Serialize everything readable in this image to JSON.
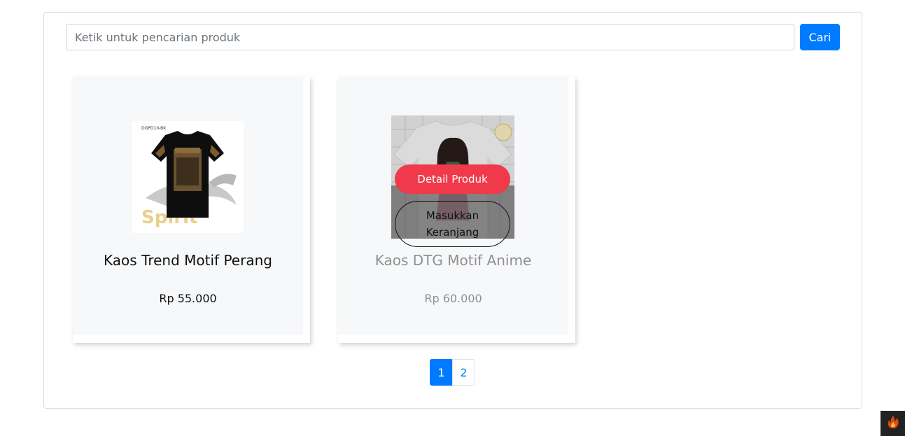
{
  "search": {
    "placeholder": "Ketik untuk pencarian produk",
    "button_label": "Cari"
  },
  "products": [
    {
      "title": "Kaos Trend Motif Perang",
      "price": "Rp 55.000",
      "image_text": "Spirit",
      "image_code": "DGPD10-BK"
    },
    {
      "title": "Kaos DTG Motif Anime",
      "price": "Rp 60.000",
      "detail_label": "Detail Produk",
      "cart_label": "Masukkan Keranjang"
    }
  ],
  "pagination": {
    "pages": [
      "1",
      "2"
    ],
    "active_page": "1"
  },
  "colors": {
    "primary": "#007bff",
    "accent": "#f0394a",
    "toolbar": "#222222"
  },
  "icons": {
    "toolbar": "flame-icon"
  }
}
